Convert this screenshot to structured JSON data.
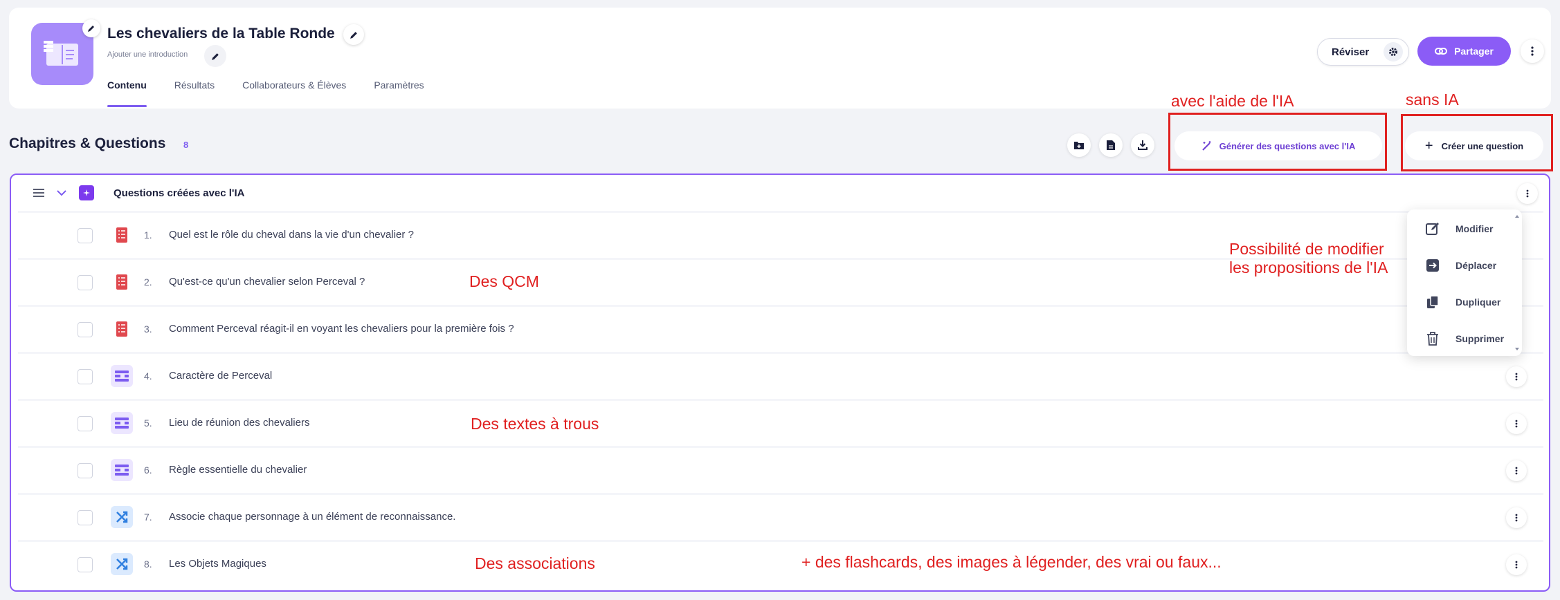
{
  "header": {
    "course_title": "Les chevaliers de la Table Ronde",
    "intro_placeholder": "Ajouter une introduction",
    "tabs": [
      "Contenu",
      "Résultats",
      "Collaborateurs & Élèves",
      "Paramètres"
    ],
    "active_tab": "Contenu",
    "review_label": "Réviser",
    "share_label": "Partager"
  },
  "section": {
    "title": "Chapitres & Questions",
    "count": "8",
    "generate_label": "Générer des questions avec l'IA",
    "create_label": "Créer une question"
  },
  "chapter": {
    "title": "Questions créées avec l'IA",
    "questions": [
      {
        "num": "1.",
        "text": "Quel est le rôle du cheval dans la vie d'un chevalier ?",
        "type": "qcm-icon"
      },
      {
        "num": "2.",
        "text": "Qu'est-ce qu'un chevalier selon Perceval ?",
        "type": "qcm-icon"
      },
      {
        "num": "3.",
        "text": "Comment Perceval réagit-il en voyant les chevaliers pour la première fois ?",
        "type": "qcm-icon"
      },
      {
        "num": "4.",
        "text": "Caractère de Perceval",
        "type": "fill-blanks-icon"
      },
      {
        "num": "5.",
        "text": "Lieu de réunion des chevaliers",
        "type": "fill-blanks-icon"
      },
      {
        "num": "6.",
        "text": "Règle essentielle du chevalier",
        "type": "fill-blanks-icon"
      },
      {
        "num": "7.",
        "text": "Associe chaque personnage à un élément de reconnaissance.",
        "type": "association-icon"
      },
      {
        "num": "8.",
        "text": "Les Objets Magiques",
        "type": "association-icon"
      }
    ]
  },
  "context_menu": {
    "items": [
      "Modifier",
      "Déplacer",
      "Dupliquer",
      "Supprimer"
    ]
  },
  "annotations": {
    "with_ai": "avec l'aide de l'IA",
    "without_ai": "sans IA",
    "modify_line1": "Possibilité de modifier",
    "modify_line2": "les propositions de l'IA",
    "qcm": "Des QCM",
    "blanks": "Des textes à trous",
    "associations": "Des associations",
    "more": "+ des flashcards, des images à légender, des vrai ou faux..."
  },
  "colors": {
    "accent": "#8b5cf6",
    "annotation_red": "#e02020",
    "qcm_red": "#e0484e",
    "blanks_purple": "#7c5cf0",
    "association_blue": "#2f7fe0"
  }
}
